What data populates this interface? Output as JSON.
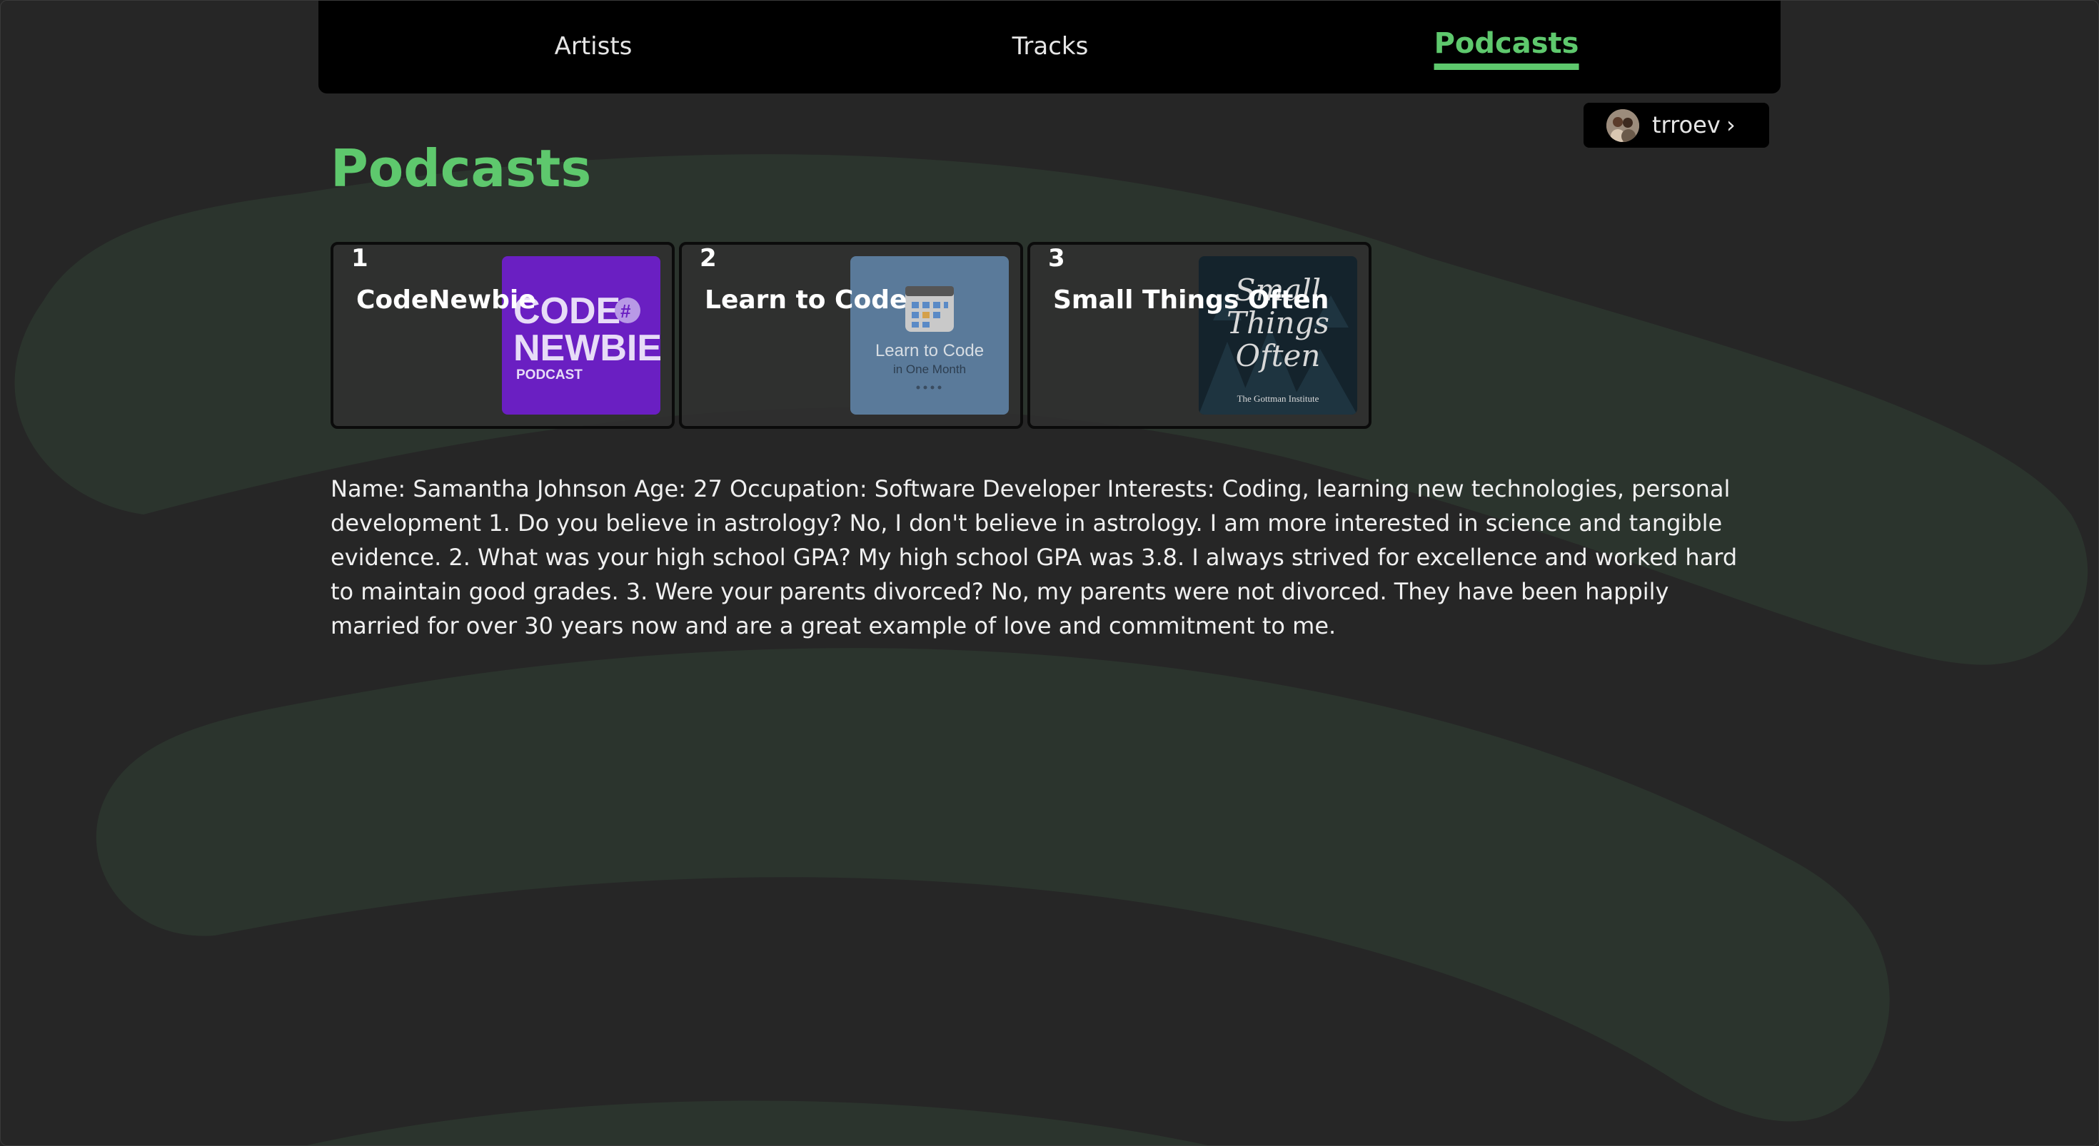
{
  "nav": {
    "artists": "Artists",
    "tracks": "Tracks",
    "podcasts": "Podcasts"
  },
  "user": {
    "name": "trroev",
    "chevron": "›"
  },
  "page": {
    "title": "Podcasts"
  },
  "podcasts": [
    {
      "rank": "1",
      "title": "CodeNewbie",
      "cover": {
        "line1": "CODE",
        "line2": "NEWBIE",
        "line3": "PODCAST",
        "badge": "#",
        "color": "#6a1fc2"
      }
    },
    {
      "rank": "2",
      "title": "Learn to Code",
      "cover": {
        "line1": "Learn to Code",
        "line2": "in One Month",
        "color": "#5a7a9a"
      }
    },
    {
      "rank": "3",
      "title": "Small Things Often",
      "cover": {
        "line1": "Small",
        "line2": "Things",
        "line3": "Often",
        "footer": "The Gottman Institute",
        "color": "#14232c"
      }
    }
  ],
  "bio": "Name: Samantha Johnson Age: 27 Occupation: Software Developer Interests: Coding, learning new technologies, personal development 1. Do you believe in astrology? No, I don't believe in astrology. I am more interested in science and tangible evidence. 2. What was your high school GPA? My high school GPA was 3.8. I always strived for excellence and worked hard to maintain good grades. 3. Were your parents divorced? No, my parents were not divorced. They have been happily married for over 30 years now and are a great example of love and commitment to me.",
  "colors": {
    "accent": "#5ec86d",
    "background": "#262626",
    "background_art": "#2b342d"
  }
}
